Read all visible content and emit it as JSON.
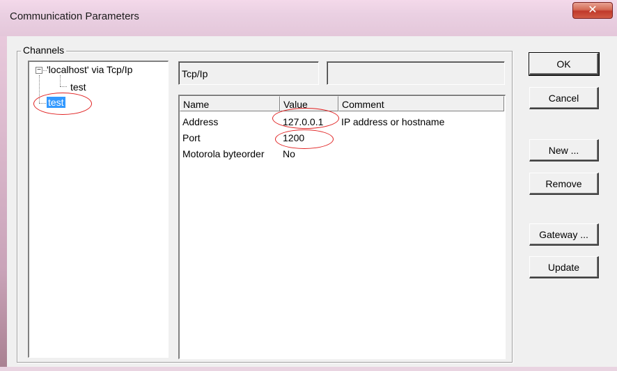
{
  "window": {
    "title": "Communication Parameters",
    "close_glyph": "✕"
  },
  "channels": {
    "group_label": "Channels",
    "tree": {
      "expander_glyph": "−",
      "root_label": "'localhost' via Tcp/Ip",
      "child_label": "test",
      "selected_label": "test"
    }
  },
  "info": {
    "protocol": "Tcp/Ip",
    "second_field": ""
  },
  "params": {
    "columns": [
      "Name",
      "Value",
      "Comment"
    ],
    "rows": [
      {
        "name": "Address",
        "value": "127.0.0.1",
        "comment": "IP address or hostname"
      },
      {
        "name": "Port",
        "value": "1200",
        "comment": ""
      },
      {
        "name": "Motorola byteorder",
        "value": "No",
        "comment": ""
      }
    ]
  },
  "buttons": {
    "ok": "OK",
    "cancel": "Cancel",
    "new": "New ...",
    "remove": "Remove",
    "gateway": "Gateway ...",
    "update": "Update"
  },
  "colors": {
    "selection": "#3399ff",
    "annotation": "#e02020",
    "dialog_bg": "#f0f0f0"
  }
}
